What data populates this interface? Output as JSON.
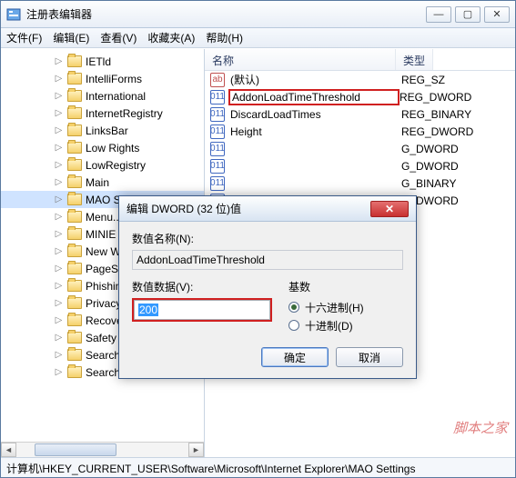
{
  "window": {
    "title": "注册表编辑器",
    "min": "—",
    "max": "▢",
    "close": "✕"
  },
  "menu": {
    "file": "文件(F)",
    "edit": "编辑(E)",
    "view": "查看(V)",
    "fav": "收藏夹(A)",
    "help": "帮助(H)"
  },
  "tree": {
    "items": [
      "IETld",
      "IntelliForms",
      "International",
      "InternetRegistry",
      "LinksBar",
      "Low Rights",
      "LowRegistry",
      "Main",
      "MAO Settings",
      "Menu...",
      "MINIE",
      "New Windows",
      "PageSetup",
      "PhishingFilter",
      "Privacy",
      "Recovery",
      "Safety",
      "SearchScopes",
      "SearchUrl"
    ],
    "selectedIndex": 8
  },
  "list": {
    "hdr_name": "名称",
    "hdr_type": "类型",
    "rows": [
      {
        "icon": "str",
        "name": "(默认)",
        "type": "REG_SZ",
        "hl": false
      },
      {
        "icon": "bin",
        "name": "AddonLoadTimeThreshold",
        "type": "REG_DWORD",
        "hl": true
      },
      {
        "icon": "bin",
        "name": "DiscardLoadTimes",
        "type": "REG_BINARY",
        "hl": false
      },
      {
        "icon": "bin",
        "name": "Height",
        "type": "REG_DWORD",
        "hl": false
      },
      {
        "icon": "bin",
        "name": "",
        "type": "G_DWORD",
        "hl": false
      },
      {
        "icon": "bin",
        "name": "",
        "type": "G_DWORD",
        "hl": false
      },
      {
        "icon": "bin",
        "name": "",
        "type": "G_BINARY",
        "hl": false
      },
      {
        "icon": "bin",
        "name": "",
        "type": "G_DWORD",
        "hl": false
      }
    ]
  },
  "status": "计算机\\HKEY_CURRENT_USER\\Software\\Microsoft\\Internet Explorer\\MAO Settings",
  "watermark": "脚本之家",
  "dialog": {
    "title": "编辑 DWORD (32 位)值",
    "name_label": "数值名称(N):",
    "name_value": "AddonLoadTimeThreshold",
    "data_label": "数值数据(V):",
    "data_value": "200",
    "base_label": "基数",
    "radio_hex": "十六进制(H)",
    "radio_dec": "十进制(D)",
    "ok": "确定",
    "cancel": "取消",
    "close_glyph": "✕"
  }
}
